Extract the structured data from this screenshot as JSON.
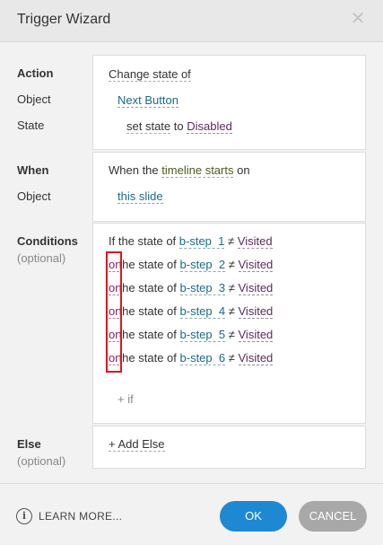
{
  "dialog": {
    "title": "Trigger Wizard",
    "close_glyph": "✕"
  },
  "labels": {
    "action": "Action",
    "object": "Object",
    "state": "State",
    "when": "When",
    "when_object": "Object",
    "conditions": "Conditions",
    "conditions_optional": "(optional)",
    "else": "Else",
    "else_optional": "(optional)"
  },
  "action_panel": {
    "action_value": "Change state of",
    "object_value": "Next Button",
    "state_prefix": "set state",
    "state_to": "to",
    "state_value": "Disabled"
  },
  "when_panel": {
    "prefix": "When the",
    "event": "timeline starts",
    "suffix": "on",
    "object_value": "this slide"
  },
  "conditions": {
    "first_prefix": "If the state of",
    "rows": [
      {
        "op": "",
        "prefix": "the state of",
        "target": "b-step  1",
        "cmp": "≠",
        "value": "Visited"
      },
      {
        "op": "or",
        "prefix": "the state of",
        "target": "b-step  2",
        "cmp": "≠",
        "value": "Visited"
      },
      {
        "op": "or",
        "prefix": "the state of",
        "target": "b-step  3",
        "cmp": "≠",
        "value": "Visited"
      },
      {
        "op": "or",
        "prefix": "the state of",
        "target": "b-step  4",
        "cmp": "≠",
        "value": "Visited"
      },
      {
        "op": "or",
        "prefix": "the state of",
        "target": "b-step  5",
        "cmp": "≠",
        "value": "Visited"
      },
      {
        "op": "or",
        "prefix": "the state of",
        "target": "b-step  6",
        "cmp": "≠",
        "value": "Visited"
      }
    ],
    "add_condition": "+ if"
  },
  "else_panel": {
    "add_else": "+ Add Else"
  },
  "footer": {
    "info_glyph": "i",
    "learn_more": "LEARN MORE...",
    "ok": "OK",
    "cancel": "CANCEL"
  },
  "colors": {
    "ok_button": "#1e88d3",
    "cancel_button": "#a8a8a8",
    "highlight": "#e0161b"
  }
}
